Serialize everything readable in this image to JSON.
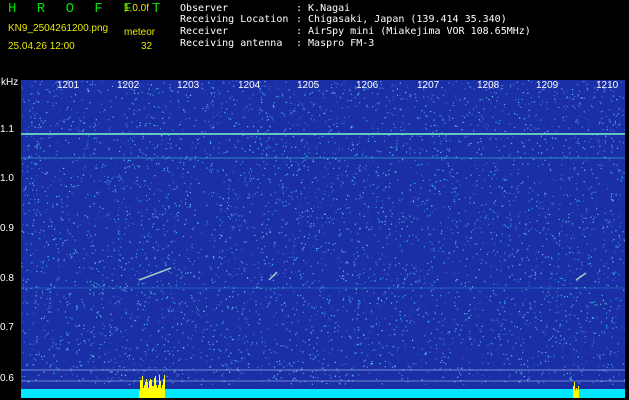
{
  "header": {
    "title": "H R O F F T",
    "version": "1.0.0f",
    "filename": "KN9_2504261200.png",
    "datetime": "25.04.26 12:00",
    "meteor_label": "meteor",
    "meteor_count": "32"
  },
  "info": [
    {
      "key": "Observer",
      "value": ": K.Nagai"
    },
    {
      "key": "Receiving Location",
      "value": ": Chigasaki, Japan (139.414 35.340)"
    },
    {
      "key": "Receiver",
      "value": ": AirSpy mini (Miakejima VOR 108.65MHz)"
    },
    {
      "key": "Receiving antenna",
      "value": ": Maspro FM-3"
    }
  ],
  "spectrogram": {
    "y_unit": "kHz",
    "y_ticks": [
      "1.1",
      "1.0",
      "0.9",
      "0.8",
      "0.7",
      "0.6"
    ],
    "x_ticks": [
      "1201",
      "1202",
      "1203",
      "1204",
      "1205",
      "1206",
      "1207",
      "1208",
      "1209",
      "1210"
    ],
    "colors": {
      "background": "#1a2fa6",
      "noise_light": "#5fb8ff",
      "noise_cyan": "#38d8e8",
      "signal_line": "#6fe0c8",
      "meteor_bars": "#ffff00",
      "bottom_bar": "#00e8ff"
    }
  }
}
